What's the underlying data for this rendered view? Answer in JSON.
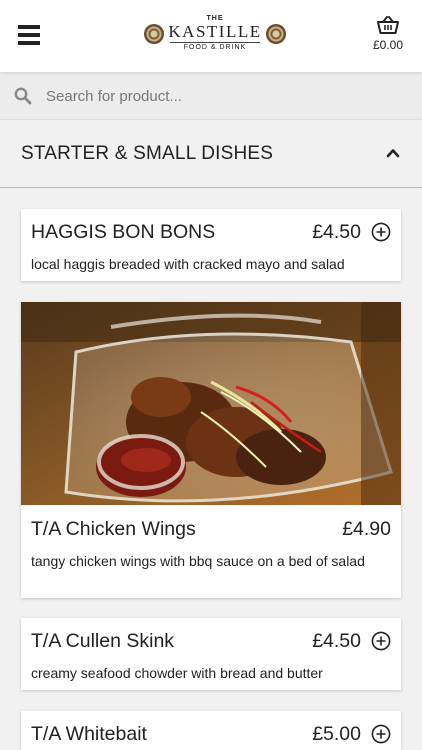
{
  "header": {
    "logo": {
      "the": "THE",
      "name": "KASTILLE",
      "sub": "FOOD & DRINK"
    },
    "cart_total": "£0.00"
  },
  "search": {
    "placeholder": "Search for product..."
  },
  "category": {
    "title": "STARTER & SMALL DISHES"
  },
  "products": [
    {
      "name": "HAGGIS BON BONS",
      "price": "£4.50",
      "description": "local haggis breaded with cracked mayo and salad"
    },
    {
      "name": "T/A Chicken Wings",
      "price": "£4.90",
      "description": "tangy chicken wings with bbq sauce on a bed of salad"
    },
    {
      "name": "T/A Cullen Skink",
      "price": "£4.50",
      "description": "creamy seafood chowder with bread and butter"
    },
    {
      "name": "T/A Whitebait",
      "price": "£5.00",
      "description": ""
    }
  ],
  "icons": {
    "menu": "hamburger-icon",
    "cart": "basket-icon",
    "search": "search-icon",
    "collapse": "chevron-up-icon",
    "add": "plus-circle-icon"
  }
}
